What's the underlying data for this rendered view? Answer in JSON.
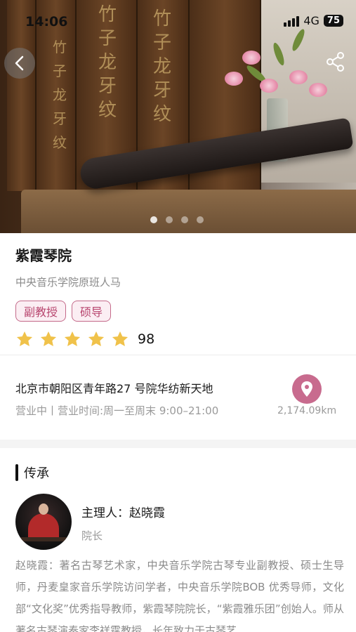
{
  "status_bar": {
    "time": "14:06",
    "network": "4G",
    "battery": "75"
  },
  "hero": {
    "calligraphy_text": "竹子龙牙纹",
    "carousel_dots": 4,
    "active_dot": 1
  },
  "header": {
    "back_icon": "chevron-left-icon",
    "share_icon": "share-icon"
  },
  "shop": {
    "name": "紫霞琴院",
    "subtitle": "中央音乐学院原班人马",
    "tags": [
      "副教授",
      "硕导"
    ],
    "star_count": 5,
    "score": "98",
    "accent_color": "#c86b8e",
    "star_color": "#f0c24a"
  },
  "location": {
    "address": "北京市朝阳区青年路27 号院华纺新天地",
    "hours": "营业中丨营业时间:周一至周末 9:00–21:00",
    "distance": "2,174.09km",
    "icon": "location-pin-icon"
  },
  "heritage": {
    "title": "传承",
    "person": "主理人：赵晓霞",
    "role": "院长",
    "bio": "赵晓霞：著名古琴艺术家，中央音乐学院古琴专业副教授、硕士生导师，丹麦皇家音乐学院访问学者，中央音乐学院BOB 优秀导师，文化部“文化奖”优秀指导教师，紫霞琴院院长，“紫霞雅乐团”创始人。师从著名古琴演奏家李祥霆教授，长年致力于古琴艺"
  }
}
